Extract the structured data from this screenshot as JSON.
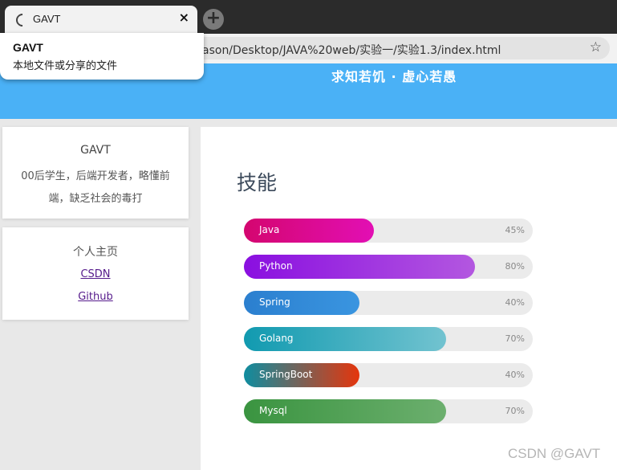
{
  "browser": {
    "tab_title": "GAVT",
    "tab_close": "×",
    "new_tab": "+",
    "url": "ason/Desktop/JAVA%20web/实验一/实验1.3/index.html",
    "bookmark_icon": "star-icon",
    "tooltip": {
      "title": "GAVT",
      "subtitle": "本地文件或分享的文件"
    }
  },
  "header": {
    "motto": "求知若饥 · 虚心若愚",
    "background": "#4ab1f6"
  },
  "profile": {
    "name": "GAVT",
    "bio": "00后学生，后端开发者，略懂前端，缺乏社会的毒打"
  },
  "links": {
    "title": "个人主页",
    "items": [
      "CSDN",
      "Github"
    ]
  },
  "skills": {
    "title": "技能",
    "items": [
      {
        "name": "Java",
        "percent": "45%",
        "value": 45,
        "gradient": [
          "#d4066f",
          "#e20fb4"
        ]
      },
      {
        "name": "Python",
        "percent": "80%",
        "value": 80,
        "gradient": [
          "#8a0fe0",
          "#b357e0"
        ]
      },
      {
        "name": "Spring",
        "percent": "40%",
        "value": 40,
        "gradient": [
          "#2b7fcf",
          "#3a95e0"
        ]
      },
      {
        "name": "Golang",
        "percent": "70%",
        "value": 70,
        "gradient": [
          "#119ab0",
          "#72c3d0"
        ]
      },
      {
        "name": "SpringBoot",
        "percent": "40%",
        "value": 40,
        "gradient": [
          "#0f8da0",
          "#e5350c"
        ]
      },
      {
        "name": "Mysql",
        "percent": "70%",
        "value": 70,
        "gradient": [
          "#3a9440",
          "#6caf6e"
        ]
      }
    ]
  },
  "watermark": "CSDN @GAVT"
}
